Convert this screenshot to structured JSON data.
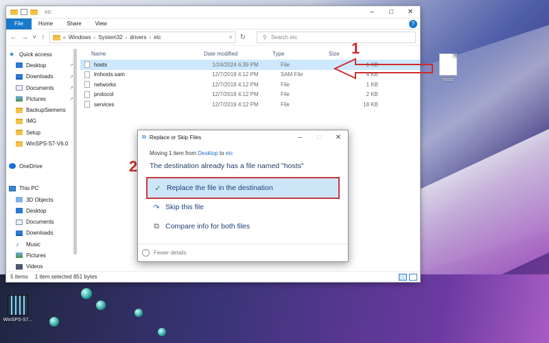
{
  "explorer": {
    "title": "etc",
    "ribbon_tabs": [
      "File",
      "Home",
      "Share",
      "View"
    ],
    "help_icon": "?",
    "breadcrumb": [
      "Windows",
      "System32",
      "drivers",
      "etc"
    ],
    "search_placeholder": "Search etc",
    "sidebar": [
      {
        "label": "Quick access",
        "icon": "star-icon",
        "pinned": false
      },
      {
        "label": "Desktop",
        "icon": "desktop-icon",
        "pinned": true
      },
      {
        "label": "Downloads",
        "icon": "download-icon",
        "pinned": true
      },
      {
        "label": "Documents",
        "icon": "documents-icon",
        "pinned": true
      },
      {
        "label": "Pictures",
        "icon": "pictures-icon",
        "pinned": true
      },
      {
        "label": "BackupSiemens",
        "icon": "folder-icon",
        "pinned": false
      },
      {
        "label": "IMG",
        "icon": "folder-icon",
        "pinned": false
      },
      {
        "label": "Setup",
        "icon": "folder-icon",
        "pinned": false
      },
      {
        "label": "WinSPS-S7-V6.0",
        "icon": "folder-icon",
        "pinned": false
      },
      {
        "label": "",
        "icon": "",
        "pinned": false
      },
      {
        "label": "OneDrive",
        "icon": "cloud-icon",
        "pinned": false
      },
      {
        "label": "",
        "icon": "",
        "pinned": false
      },
      {
        "label": "This PC",
        "icon": "computer-icon",
        "pinned": false
      },
      {
        "label": "3D Objects",
        "icon": "cube-icon",
        "pinned": false
      },
      {
        "label": "Desktop",
        "icon": "desktop-icon",
        "pinned": false
      },
      {
        "label": "Documents",
        "icon": "documents-icon",
        "pinned": false
      },
      {
        "label": "Downloads",
        "icon": "download-icon",
        "pinned": false
      },
      {
        "label": "Music",
        "icon": "music-icon",
        "pinned": false
      },
      {
        "label": "Pictures",
        "icon": "pictures-icon",
        "pinned": false
      },
      {
        "label": "Videos",
        "icon": "video-icon",
        "pinned": false
      }
    ],
    "columns": {
      "name": "Name",
      "date": "Date modified",
      "type": "Type",
      "size": "Size"
    },
    "files": [
      {
        "name": "hosts",
        "date": "1/24/2024 6:39 PM",
        "type": "File",
        "size": "1 KB",
        "selected": true
      },
      {
        "name": "lmhosts.sam",
        "date": "12/7/2019 4:12 PM",
        "type": "SAM File",
        "size": "4 KB",
        "selected": false
      },
      {
        "name": "networks",
        "date": "12/7/2019 4:12 PM",
        "type": "File",
        "size": "1 KB",
        "selected": false
      },
      {
        "name": "protocol",
        "date": "12/7/2019 4:12 PM",
        "type": "File",
        "size": "2 KB",
        "selected": false
      },
      {
        "name": "services",
        "date": "12/7/2019 4:12 PM",
        "type": "File",
        "size": "18 KB",
        "selected": false
      }
    ],
    "status": {
      "count": "5 items",
      "selection": "1 item selected  851 bytes"
    }
  },
  "dialog": {
    "title": "Replace or Skip Files",
    "moving_prefix": "Moving 1 item from",
    "moving_from": "Desktop",
    "moving_to_word": "to",
    "moving_to": "etc",
    "heading": "The destination already has a file named \"hosts\"",
    "options": [
      {
        "label": "Replace the file in the destination",
        "icon": "checkmark-icon",
        "highlighted": true
      },
      {
        "label": "Skip this file",
        "icon": "skip-icon",
        "highlighted": false
      },
      {
        "label": "Compare info for both files",
        "icon": "compare-icon",
        "highlighted": false
      }
    ],
    "fewer_details": "Fewer details"
  },
  "annotations": {
    "step1": "1",
    "step2": "2",
    "color": "#d12a2a"
  },
  "desktop": {
    "hosts_label": "hosts",
    "winsps_label": "WinSPS-S7..."
  }
}
